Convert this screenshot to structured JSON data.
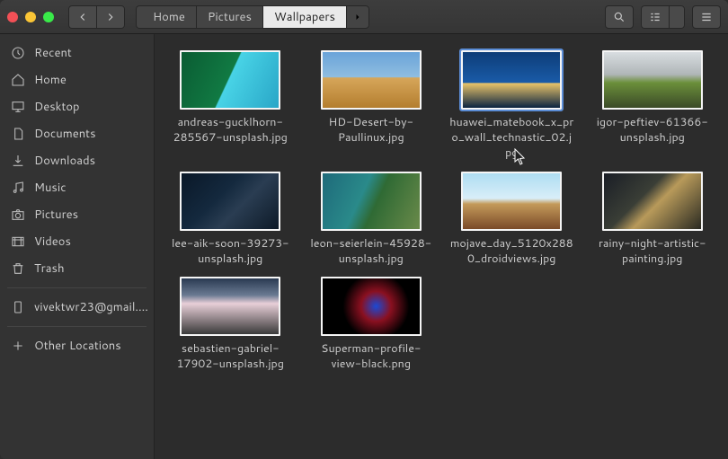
{
  "toolbar": {
    "breadcrumbs": [
      {
        "label": "Home",
        "has_home_icon": true
      },
      {
        "label": "Pictures",
        "has_home_icon": false
      },
      {
        "label": "Wallpapers",
        "has_home_icon": false,
        "active": true
      }
    ]
  },
  "sidebar": {
    "items": [
      {
        "id": "recent",
        "label": "Recent",
        "icon": "clock-icon"
      },
      {
        "id": "home",
        "label": "Home",
        "icon": "home-icon"
      },
      {
        "id": "desktop",
        "label": "Desktop",
        "icon": "desktop-icon"
      },
      {
        "id": "documents",
        "label": "Documents",
        "icon": "documents-icon"
      },
      {
        "id": "downloads",
        "label": "Downloads",
        "icon": "download-icon"
      },
      {
        "id": "music",
        "label": "Music",
        "icon": "music-icon"
      },
      {
        "id": "pictures",
        "label": "Pictures",
        "icon": "camera-icon"
      },
      {
        "id": "videos",
        "label": "Videos",
        "icon": "video-icon"
      },
      {
        "id": "trash",
        "label": "Trash",
        "icon": "trash-icon"
      }
    ],
    "account_label": "vivektwr23@gmail....",
    "other_locations_label": "Other Locations"
  },
  "files": [
    {
      "name": "andreas-gucklhorn-285567-unsplash.jpg",
      "thumb_style": "linear-gradient(115deg,#0a5c33 0%,#117a43 48%,#48d3e6 49%,#29a6c7 100%)"
    },
    {
      "name": "HD-Desert-by-Paullinux.jpg",
      "thumb_style": "linear-gradient(#6aa4d9 0%,#8fbde0 45%,#d6a65a 46%,#b47e2f 100%)"
    },
    {
      "name": "huawei_matebook_x_pro_wall_technastic_02.jpg",
      "selected": true,
      "thumb_style": "linear-gradient(#0d3d78 0%,#1a5ba8 55%,#e8c46a 56%,#0b2340 100%)"
    },
    {
      "name": "igor-peftiev-61366-unsplash.jpg",
      "thumb_style": "linear-gradient(#d8dde0 0%,#b0b6b8 40%,#6b8f3a 55%,#3b4a28 100%)"
    },
    {
      "name": "lee-aik-soon-39273-unsplash.jpg",
      "thumb_style": "linear-gradient(135deg,#0a1828 0%,#14293e 40%,#2a3d52 60%,#0d1a28 100%)"
    },
    {
      "name": "leon-seierlein-45928-unsplash.jpg",
      "thumb_style": "linear-gradient(115deg,#1e6a7a 0%,#2a8a8a 40%,#2f6a34 55%,#6a8a4a 100%)"
    },
    {
      "name": "mojave_day_5120x2880_droidviews.jpg",
      "thumb_style": "linear-gradient(#aeddf2 0%,#d9eef8 45%,#c49a5a 55%,#7a4a28 100%)"
    },
    {
      "name": "rainy-night-artistic-painting.jpg",
      "thumb_style": "linear-gradient(135deg,#1a1e26 0%,#3a3e36 40%,#b89a5a 55%,#2a2a22 100%)"
    },
    {
      "name": "sebastien-gabriel-17902-unsplash.jpg",
      "thumb_style": "linear-gradient(#2a3a52 0%,#6a7a92 30%,#e8cfd8 45%,#3a3a3a 100%)"
    },
    {
      "name": "Superman-profile-view-black.png",
      "thumb_style": "radial-gradient(circle at 55% 50%,#1a4ad6 0%,#8a1020 25%,#000 55%,#000 100%)"
    }
  ]
}
